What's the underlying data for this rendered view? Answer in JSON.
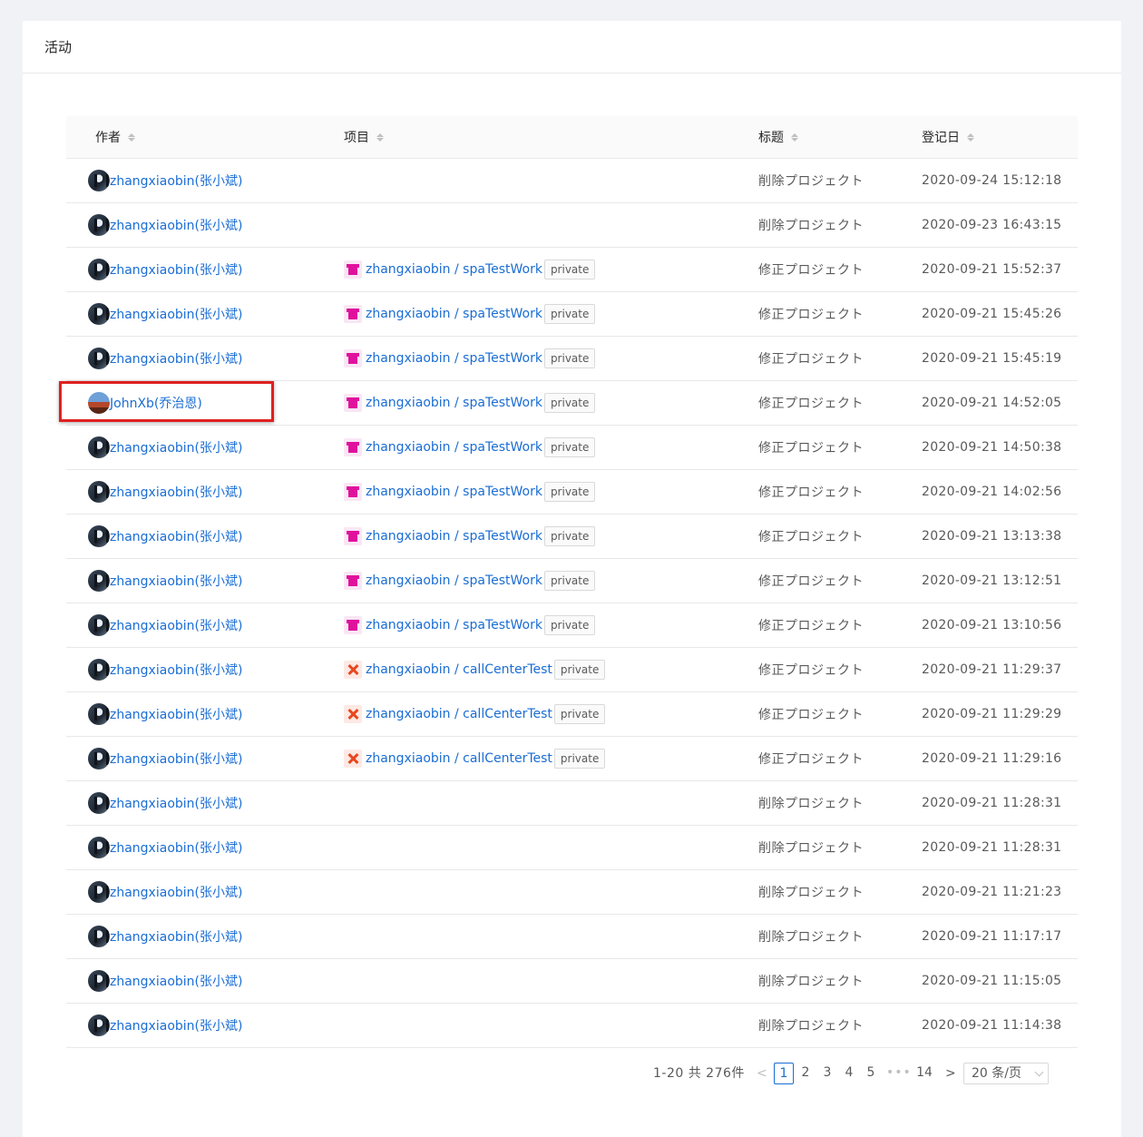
{
  "page": {
    "title": "活动"
  },
  "table": {
    "headers": {
      "author": "作者",
      "project": "项目",
      "title": "标题",
      "date": "登记日"
    },
    "rows": [
      {
        "author": "zhangxiaobin(张小斌)",
        "avatar": "zx",
        "project": "",
        "project_icon": "",
        "badge": "",
        "title": "削除プロジェクト",
        "date": "2020-09-24 15:12:18"
      },
      {
        "author": "zhangxiaobin(张小斌)",
        "avatar": "zx",
        "project": "",
        "project_icon": "",
        "badge": "",
        "title": "削除プロジェクト",
        "date": "2020-09-23 16:43:15"
      },
      {
        "author": "zhangxiaobin(张小斌)",
        "avatar": "zx",
        "project": "zhangxiaobin / spaTestWork",
        "project_icon": "shirt",
        "badge": "private",
        "title": "修正プロジェクト",
        "date": "2020-09-21 15:52:37"
      },
      {
        "author": "zhangxiaobin(张小斌)",
        "avatar": "zx",
        "project": "zhangxiaobin / spaTestWork",
        "project_icon": "shirt",
        "badge": "private",
        "title": "修正プロジェクト",
        "date": "2020-09-21 15:45:26"
      },
      {
        "author": "zhangxiaobin(张小斌)",
        "avatar": "zx",
        "project": "zhangxiaobin / spaTestWork",
        "project_icon": "shirt",
        "badge": "private",
        "title": "修正プロジェクト",
        "date": "2020-09-21 15:45:19"
      },
      {
        "author": "JohnXb(乔治恩)",
        "avatar": "jx",
        "project": "zhangxiaobin / spaTestWork",
        "project_icon": "shirt",
        "badge": "private",
        "title": "修正プロジェクト",
        "date": "2020-09-21 14:52:05"
      },
      {
        "author": "zhangxiaobin(张小斌)",
        "avatar": "zx",
        "project": "zhangxiaobin / spaTestWork",
        "project_icon": "shirt",
        "badge": "private",
        "title": "修正プロジェクト",
        "date": "2020-09-21 14:50:38"
      },
      {
        "author": "zhangxiaobin(张小斌)",
        "avatar": "zx",
        "project": "zhangxiaobin / spaTestWork",
        "project_icon": "shirt",
        "badge": "private",
        "title": "修正プロジェクト",
        "date": "2020-09-21 14:02:56"
      },
      {
        "author": "zhangxiaobin(张小斌)",
        "avatar": "zx",
        "project": "zhangxiaobin / spaTestWork",
        "project_icon": "shirt",
        "badge": "private",
        "title": "修正プロジェクト",
        "date": "2020-09-21 13:13:38"
      },
      {
        "author": "zhangxiaobin(张小斌)",
        "avatar": "zx",
        "project": "zhangxiaobin / spaTestWork",
        "project_icon": "shirt",
        "badge": "private",
        "title": "修正プロジェクト",
        "date": "2020-09-21 13:12:51"
      },
      {
        "author": "zhangxiaobin(张小斌)",
        "avatar": "zx",
        "project": "zhangxiaobin / spaTestWork",
        "project_icon": "shirt",
        "badge": "private",
        "title": "修正プロジェクト",
        "date": "2020-09-21 13:10:56"
      },
      {
        "author": "zhangxiaobin(张小斌)",
        "avatar": "zx",
        "project": "zhangxiaobin / callCenterTest",
        "project_icon": "cross",
        "badge": "private",
        "title": "修正プロジェクト",
        "date": "2020-09-21 11:29:37"
      },
      {
        "author": "zhangxiaobin(张小斌)",
        "avatar": "zx",
        "project": "zhangxiaobin / callCenterTest",
        "project_icon": "cross",
        "badge": "private",
        "title": "修正プロジェクト",
        "date": "2020-09-21 11:29:29"
      },
      {
        "author": "zhangxiaobin(张小斌)",
        "avatar": "zx",
        "project": "zhangxiaobin / callCenterTest",
        "project_icon": "cross",
        "badge": "private",
        "title": "修正プロジェクト",
        "date": "2020-09-21 11:29:16"
      },
      {
        "author": "zhangxiaobin(张小斌)",
        "avatar": "zx",
        "project": "",
        "project_icon": "",
        "badge": "",
        "title": "削除プロジェクト",
        "date": "2020-09-21 11:28:31"
      },
      {
        "author": "zhangxiaobin(张小斌)",
        "avatar": "zx",
        "project": "",
        "project_icon": "",
        "badge": "",
        "title": "削除プロジェクト",
        "date": "2020-09-21 11:28:31"
      },
      {
        "author": "zhangxiaobin(张小斌)",
        "avatar": "zx",
        "project": "",
        "project_icon": "",
        "badge": "",
        "title": "削除プロジェクト",
        "date": "2020-09-21 11:21:23"
      },
      {
        "author": "zhangxiaobin(张小斌)",
        "avatar": "zx",
        "project": "",
        "project_icon": "",
        "badge": "",
        "title": "削除プロジェクト",
        "date": "2020-09-21 11:17:17"
      },
      {
        "author": "zhangxiaobin(张小斌)",
        "avatar": "zx",
        "project": "",
        "project_icon": "",
        "badge": "",
        "title": "削除プロジェクト",
        "date": "2020-09-21 11:15:05"
      },
      {
        "author": "zhangxiaobin(张小斌)",
        "avatar": "zx",
        "project": "",
        "project_icon": "",
        "badge": "",
        "title": "削除プロジェクト",
        "date": "2020-09-21 11:14:38"
      }
    ]
  },
  "pagination": {
    "total_text": "1-20 共 276件",
    "prev": "<",
    "pages": [
      "1",
      "2",
      "3",
      "4",
      "5"
    ],
    "current": "1",
    "more": "•••",
    "last": "14",
    "next": ">",
    "page_size": "20 条/页"
  },
  "colors": {
    "link": "#1a6dd4",
    "highlight": "#e02020",
    "page_bg": "#f0f2f5"
  }
}
